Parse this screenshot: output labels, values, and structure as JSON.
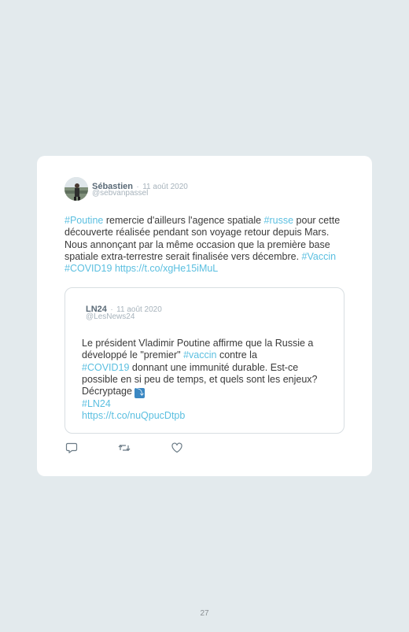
{
  "tweet": {
    "author": "Sébastien",
    "dot": "·",
    "date": "11 août 2020",
    "handle": "@sebvanpassel",
    "text": [
      {
        "t": "#Poutine",
        "tag": true
      },
      {
        "t": " remercie d'ailleurs l'agence spatiale ",
        "tag": false
      },
      {
        "t": "#russe",
        "tag": true
      },
      {
        "t": " pour cette découverte réalisée pendant son voyage retour depuis Mars. Nous annonçant par la même occasion que la première base spatiale extra-terrestre serait finalisée vers décembre. ",
        "tag": false
      },
      {
        "t": "#Vaccin",
        "tag": true
      },
      {
        "t": " ",
        "tag": false
      },
      {
        "t": "#COVID19",
        "tag": true
      },
      {
        "t": " ",
        "tag": false
      },
      {
        "t": "https://t.co/xgHe15iMuL",
        "tag": true
      }
    ]
  },
  "quote": {
    "author": "LN24",
    "dot": "·",
    "date": "11 août 2020",
    "handle": "@LesNews24",
    "text_1": "Le président Vladimir Poutine affirme que la Russie a développé le \"premier\" ",
    "tag_vaccin": "#vaccin",
    "text_2": " contre la ",
    "tag_covid": "#COVID19",
    "text_3": " donnant une immunité durable. Est-ce possible en si peu de temps, et quels sont les enjeux? Décryptage ",
    "emoji": "⤵",
    "tag_ln24": "#LN24",
    "link": "https://t.co/nuQpucDtpb"
  },
  "actions": {
    "reply_icon": "reply-icon",
    "retweet_icon": "retweet-icon",
    "like_icon": "heart-icon"
  },
  "colors": {
    "hashtag": "#5bbfe0",
    "background": "#e3eaed"
  },
  "page_number": "27"
}
